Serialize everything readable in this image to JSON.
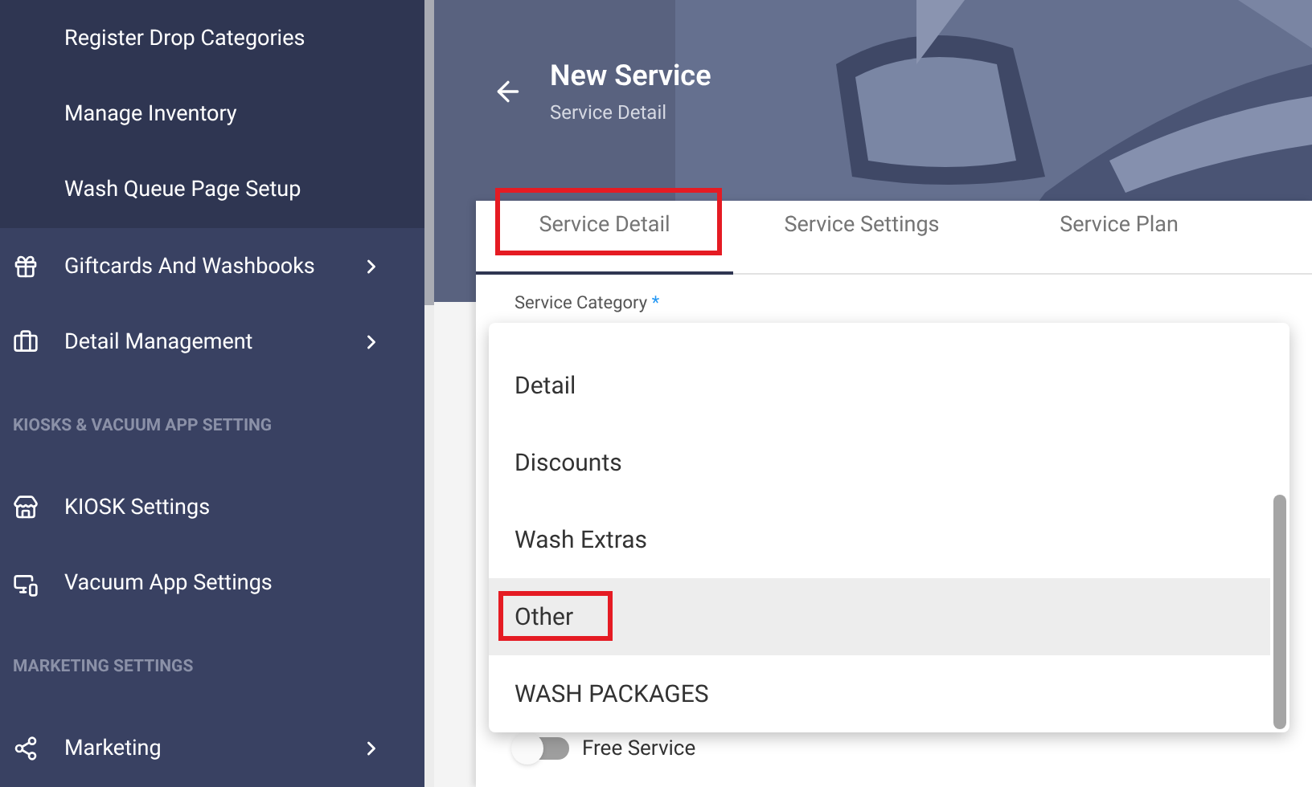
{
  "sidebar": {
    "items": [
      {
        "kind": "subitem",
        "label": "Register Drop Categories"
      },
      {
        "kind": "subitem",
        "label": "Manage Inventory"
      },
      {
        "kind": "subitem",
        "label": "Wash Queue Page Setup"
      },
      {
        "kind": "item",
        "label": "Giftcards And Washbooks",
        "expandable": true
      },
      {
        "kind": "item",
        "label": "Detail Management",
        "expandable": true
      },
      {
        "kind": "section",
        "label": "KIOSKS & VACUUM APP SETTING"
      },
      {
        "kind": "item",
        "label": "KIOSK Settings",
        "expandable": false
      },
      {
        "kind": "item",
        "label": "Vacuum App Settings",
        "expandable": false
      },
      {
        "kind": "section",
        "label": "MARKETING SETTINGS"
      },
      {
        "kind": "item",
        "label": "Marketing",
        "expandable": true
      }
    ]
  },
  "header": {
    "title": "New Service",
    "subtitle": "Service Detail"
  },
  "tabs": [
    {
      "label": "Service Detail",
      "selected": true
    },
    {
      "label": "Service Settings",
      "selected": false
    },
    {
      "label": "Service Plan",
      "selected": false
    }
  ],
  "form": {
    "category_label": "Service Category",
    "required_mark": "*",
    "free_service": {
      "label": "Free Service",
      "on": false
    }
  },
  "dropdown": {
    "options": [
      {
        "label": "Detail",
        "highlighted": false
      },
      {
        "label": "Discounts",
        "highlighted": false
      },
      {
        "label": "Wash Extras",
        "highlighted": false
      },
      {
        "label": "Other",
        "highlighted": true
      },
      {
        "label": "WASH PACKAGES",
        "highlighted": false
      }
    ]
  }
}
